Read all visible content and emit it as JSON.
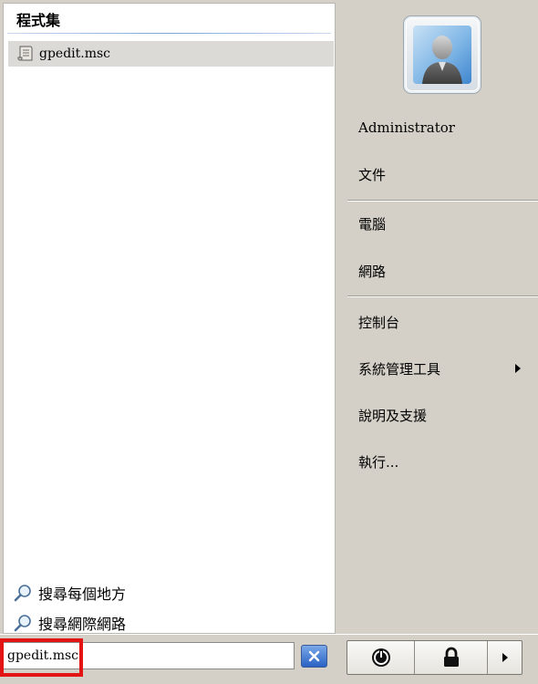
{
  "programs": {
    "title": "程式集",
    "results": [
      {
        "label": "gpedit.msc",
        "icon": "script-file-icon"
      }
    ]
  },
  "search_links": {
    "everywhere": "搜尋每個地方",
    "internet": "搜尋網際網路"
  },
  "right_menu": {
    "username": "Administrator",
    "documents": "文件",
    "computer": "電腦",
    "network": "網路",
    "control_panel": "控制台",
    "admin_tools": "系統管理工具",
    "help_support": "說明及支援",
    "run": "執行..."
  },
  "search_box": {
    "value": "gpedit.msc"
  },
  "colors": {
    "highlight_border": "#e31414",
    "left_panel_bg": "#ffffff",
    "right_panel_bg": "#d4d0c8",
    "selected_result_bg": "#dbdad6"
  }
}
